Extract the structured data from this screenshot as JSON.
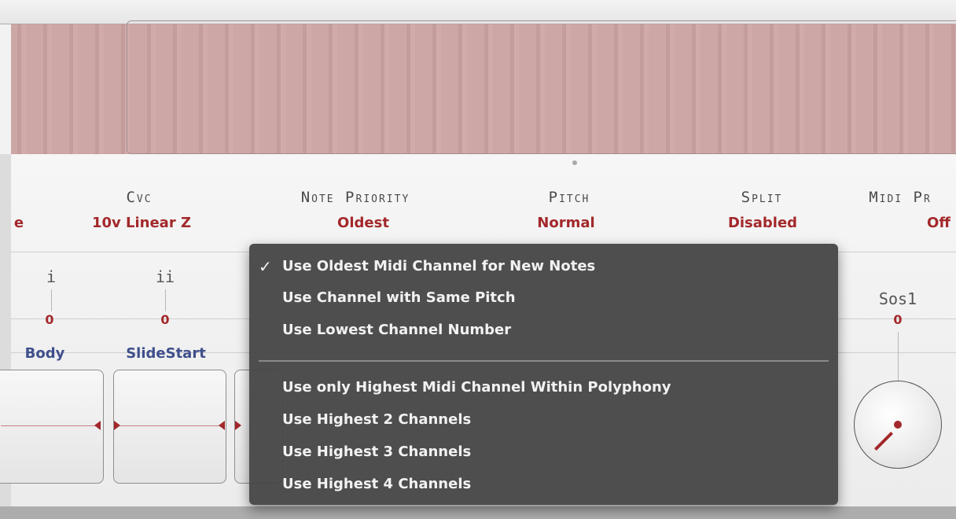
{
  "parameters": [
    {
      "label": "Cvc",
      "value": "10v Linear Z"
    },
    {
      "label": "Note Priority",
      "value": "Oldest"
    },
    {
      "label": "Pitch",
      "value": "Normal"
    },
    {
      "label": "Split",
      "value": "Disabled"
    },
    {
      "label": "Midi Pr",
      "value": "Off"
    },
    {
      "partial_value": "e"
    }
  ],
  "controls": {
    "i": {
      "label": "i",
      "value": "0",
      "destination": "Body"
    },
    "ii": {
      "label": "ii",
      "value": "0",
      "destination": "SlideStart"
    },
    "knob": {
      "label": "Sos1",
      "value": "0"
    }
  },
  "note_priority_menu": {
    "checkmark": "✓",
    "selected_index": 0,
    "group1": [
      "Use Oldest Midi Channel for New Notes",
      "Use Channel with Same Pitch",
      "Use Lowest Channel Number"
    ],
    "group2": [
      "Use only Highest Midi Channel Within Polyphony",
      "Use Highest 2 Channels",
      "Use Highest 3 Channels",
      "Use Highest 4 Channels"
    ]
  },
  "colors": {
    "value_red": "#a3282b",
    "destination_blue": "#3f4f8c",
    "menu_bg": "#484848",
    "keyboard_pink": "#cda6a6"
  }
}
